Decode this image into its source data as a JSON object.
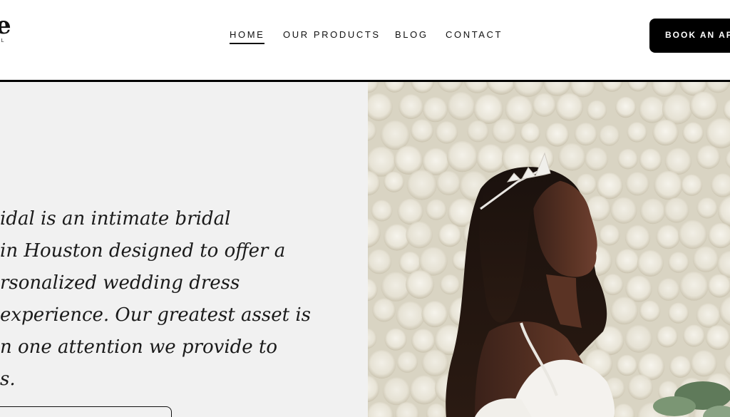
{
  "header": {
    "logo": {
      "mark": "e",
      "sub": "AL"
    },
    "nav": [
      {
        "label": "HOME",
        "active": true
      },
      {
        "label": "OUR PRODUCTS",
        "active": false
      },
      {
        "label": "BLOG",
        "active": false
      },
      {
        "label": "CONTACT",
        "active": false
      }
    ],
    "cta_label": "BOOK AN AP"
  },
  "intro": {
    "lines": [
      "idal is an intimate bridal",
      "in Houston designed to offer a",
      "rsonalized wedding dress",
      "experience. Our greatest asset is",
      "n one attention we provide to",
      "s."
    ]
  },
  "colors": {
    "header_rule": "#000000",
    "panel_bg": "#f1f1f1",
    "cta_bg": "#000000",
    "cta_text": "#ffffff"
  }
}
